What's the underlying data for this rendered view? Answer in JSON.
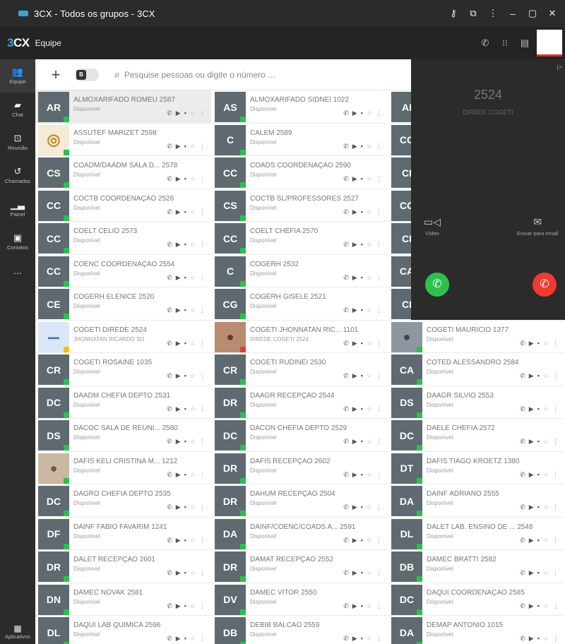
{
  "window": {
    "title": "3CX - Todos os grupos - 3CX"
  },
  "app": {
    "logo_prefix": "3",
    "logo_suffix": "CX",
    "section": "Equipe"
  },
  "nav": {
    "items": [
      {
        "label": "Equipe",
        "icon": "team-icon"
      },
      {
        "label": "Chat",
        "icon": "chat-icon"
      },
      {
        "label": "Reunião",
        "icon": "meeting-icon"
      },
      {
        "label": "Chamadas",
        "icon": "calls-icon"
      },
      {
        "label": "Painel",
        "icon": "panel-icon"
      },
      {
        "label": "Contatos",
        "icon": "contacts-icon"
      }
    ],
    "more": "...",
    "apps_label": "Aplicativos"
  },
  "toolbar": {
    "add": "+",
    "toggle_letter": "B",
    "search_placeholder": "Pesquise pessoas ou digite o número ..."
  },
  "call": {
    "extension": "2524",
    "name": "DIREDE COGETI",
    "video_label": "Vídeo",
    "email_label": "Enviar para email"
  },
  "contacts": {
    "col1": [
      {
        "initials": "AR",
        "name": "ALMOXARIFADO ROMEU 2587",
        "status": "Disponível"
      },
      {
        "initials": "",
        "name": "ASSUTEF MARIZET 2598",
        "status": "Disponível"
      },
      {
        "initials": "CS",
        "name": "COADM/DAADM SALA D...   2578",
        "status": "Disponível"
      },
      {
        "initials": "CC",
        "name": "COCTB COORDENAÇÃO 2526",
        "status": "Disponível"
      },
      {
        "initials": "CC",
        "name": "COELT CELIO 2573",
        "status": "Disponível"
      },
      {
        "initials": "CC",
        "name": "COENC COORDENAÇÃO 2554",
        "status": "Disponível"
      },
      {
        "initials": "CE",
        "name": "COGERH ELENICE 2520",
        "status": "Disponível"
      },
      {
        "initials": "",
        "name": "COGETI DIREDE 2524",
        "status": "JHONNATAN RICARDO SOMLER..."
      },
      {
        "initials": "CR",
        "name": "COGETI ROSAINE 1035",
        "status": "Disponível"
      },
      {
        "initials": "DC",
        "name": "DAADM CHEFIA DEPTO 2531",
        "status": "Disponível"
      },
      {
        "initials": "DS",
        "name": "DACOC SALA DE REUNI...   2580",
        "status": "Disponível"
      },
      {
        "initials": "",
        "name": "DAFIS KELI CRISTINA M...   1212",
        "status": "Disponível"
      },
      {
        "initials": "DC",
        "name": "DAGRO CHEFIA DEPTO 2535",
        "status": "Disponível"
      },
      {
        "initials": "DF",
        "name": "DAINF FABIO FAVARIM 1241",
        "status": "Disponível"
      },
      {
        "initials": "DR",
        "name": "DALET RECEPÇÃO 2601",
        "status": "Disponível"
      },
      {
        "initials": "DN",
        "name": "DAMEC NOVAK 2581",
        "status": "Disponível"
      },
      {
        "initials": "DL",
        "name": "DAQUI LAB QUIMICA 2596",
        "status": "Disponível"
      }
    ],
    "col2": [
      {
        "initials": "AS",
        "name": "ALMOXARIFADO SIDNEI 1022",
        "status": "Disponível"
      },
      {
        "initials": "C",
        "name": "CALEM 2589",
        "status": "Disponível"
      },
      {
        "initials": "CC",
        "name": "COADS COORDENAÇÃO 2590",
        "status": "Disponível"
      },
      {
        "initials": "CS",
        "name": "COCTB SL/PROFESSORES 2527",
        "status": "Disponível"
      },
      {
        "initials": "CC",
        "name": "COELT CHEFIA 2570",
        "status": "Disponível"
      },
      {
        "initials": "C",
        "name": "COGERH 2532",
        "status": "Disponível"
      },
      {
        "initials": "CG",
        "name": "COGERH GISELE 2521",
        "status": "Disponível"
      },
      {
        "initials": "",
        "name": "COGETI JHONNATAN RIC...   1101",
        "status": "DIREDE COGETI 2524"
      },
      {
        "initials": "CR",
        "name": "COGETI RUDINEI 2530",
        "status": "Disponível"
      },
      {
        "initials": "DR",
        "name": "DAAGR RECEPÇÃO 2544",
        "status": "Disponível"
      },
      {
        "initials": "DC",
        "name": "DACON CHEFIA DEPTO 2529",
        "status": "Disponível"
      },
      {
        "initials": "DR",
        "name": "DAFIS RECEPÇÃO 2602",
        "status": "Disponível"
      },
      {
        "initials": "DR",
        "name": "DAHUM RECEPÇÃO 2504",
        "status": "Disponível"
      },
      {
        "initials": "DA",
        "name": "DAINF/COENC/COADS A...   2591",
        "status": "Disponível"
      },
      {
        "initials": "DR",
        "name": "DAMAT RECEPÇÃO 2552",
        "status": "Disponível"
      },
      {
        "initials": "DV",
        "name": "DAMEC VITOR 2550",
        "status": "Disponível"
      },
      {
        "initials": "DB",
        "name": "DEBIB BALCÃO 2559",
        "status": "Disponível"
      }
    ],
    "col3": [
      {
        "initials": "AI",
        "name": "",
        "status": ""
      },
      {
        "initials": "CC",
        "name": "",
        "status": ""
      },
      {
        "initials": "CI",
        "name": "",
        "status": ""
      },
      {
        "initials": "CC",
        "name": "",
        "status": ""
      },
      {
        "initials": "CI",
        "name": "",
        "status": ""
      },
      {
        "initials": "CA",
        "name": "",
        "status": ""
      },
      {
        "initials": "CI",
        "name": "",
        "status": ""
      },
      {
        "initials": "",
        "name": "COGETI MAURICIO 1377",
        "status": "Disponível"
      },
      {
        "initials": "CA",
        "name": "COTED ALESSANDRO 2584",
        "status": "Disponível"
      },
      {
        "initials": "DS",
        "name": "DAAGR SILVIO 2553",
        "status": "Disponível"
      },
      {
        "initials": "DC",
        "name": "DAELE CHEFIA 2572",
        "status": "Disponível"
      },
      {
        "initials": "DT",
        "name": "DAFIS TIAGO KROETZ 1380",
        "status": "Disponível"
      },
      {
        "initials": "DA",
        "name": "DAINF ADRIANO 2555",
        "status": "Disponível"
      },
      {
        "initials": "DL",
        "name": "DALET LAB. ENSINO DE ...   2548",
        "status": "Disponível"
      },
      {
        "initials": "DB",
        "name": "DAMEC BRATTI 2582",
        "status": "Disponível"
      },
      {
        "initials": "DC",
        "name": "DAQUI COORDENAÇÃO 2585",
        "status": "Disponível"
      },
      {
        "initials": "DA",
        "name": "DEMAP ANTONIO 1015",
        "status": "Disponível"
      }
    ]
  },
  "colors": {
    "online": "#27c24c",
    "busy": "#e53935",
    "away": "#f2c200",
    "avatar": "#5e6a70",
    "answer": "#2fbf4f",
    "hangup": "#f03a2e"
  }
}
